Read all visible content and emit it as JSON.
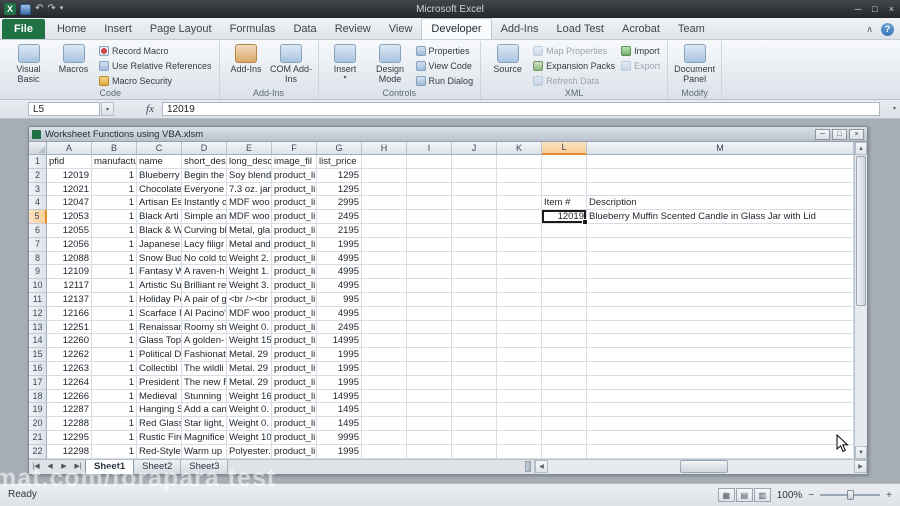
{
  "app": {
    "title": "Microsoft Excel"
  },
  "window_controls": {
    "minimize": "─",
    "maximize": "□",
    "close": "×"
  },
  "qat": {
    "excel": "X",
    "undo": "↶",
    "redo": "↷",
    "dropdown": "▾"
  },
  "tab_row": {
    "tabs": [
      {
        "label": "File",
        "file": true
      },
      {
        "label": "Home"
      },
      {
        "label": "Insert"
      },
      {
        "label": "Page Layout"
      },
      {
        "label": "Formulas"
      },
      {
        "label": "Data"
      },
      {
        "label": "Review"
      },
      {
        "label": "View"
      },
      {
        "label": "Developer",
        "active": true
      },
      {
        "label": "Add-Ins"
      },
      {
        "label": "Load Test"
      },
      {
        "label": "Acrobat"
      },
      {
        "label": "Team"
      }
    ],
    "collapse": "∧",
    "help": "?"
  },
  "ribbon": {
    "groups": [
      {
        "label": "Code",
        "big": [
          {
            "label": "Visual Basic",
            "icon": "visual-basic-icon"
          },
          {
            "label": "Macros",
            "icon": "macros-icon"
          }
        ],
        "cols": [
          [
            {
              "label": "Record Macro",
              "icon": "record-macro-icon"
            },
            {
              "label": "Use Relative References",
              "icon": "relative-references-icon"
            },
            {
              "label": "Macro Security",
              "icon": "macro-security-icon"
            }
          ]
        ]
      },
      {
        "label": "Add-Ins",
        "big": [
          {
            "label": "Add-Ins",
            "icon": "add-ins-icon"
          },
          {
            "label": "COM Add-Ins",
            "icon": "com-add-ins-icon"
          }
        ],
        "cols": []
      },
      {
        "label": "Controls",
        "big": [
          {
            "label": "Insert",
            "icon": "insert-icon",
            "dropdown": true
          },
          {
            "label": "Design Mode",
            "icon": "design-mode-icon"
          }
        ],
        "cols": [
          [
            {
              "label": "Properties",
              "icon": "properties-icon"
            },
            {
              "label": "View Code",
              "icon": "view-code-icon"
            },
            {
              "label": "Run Dialog",
              "icon": "run-dialog-icon"
            }
          ]
        ]
      },
      {
        "label": "XML",
        "big": [
          {
            "label": "Source",
            "icon": "source-icon"
          }
        ],
        "cols": [
          [
            {
              "label": "Map Properties",
              "icon": "map-properties-icon",
              "disabled": true
            },
            {
              "label": "Expansion Packs",
              "icon": "expansion-packs-icon"
            },
            {
              "label": "Refresh Data",
              "icon": "refresh-data-icon",
              "disabled": true
            }
          ],
          [
            {
              "label": "Import",
              "icon": "import-icon"
            },
            {
              "label": "Export",
              "icon": "export-icon",
              "disabled": true
            }
          ]
        ]
      },
      {
        "label": "Modify",
        "big": [
          {
            "label": "Document Panel",
            "icon": "document-panel-icon"
          }
        ],
        "cols": []
      }
    ]
  },
  "formula_bar": {
    "name_box": "L5",
    "fx": "fx",
    "value": "12019",
    "dropdown": "▾"
  },
  "workbook": {
    "title": "Worksheet Functions using VBA.xlsm"
  },
  "grid": {
    "selection": "L5",
    "columns": [
      "A",
      "B",
      "C",
      "D",
      "E",
      "F",
      "G",
      "H",
      "I",
      "J",
      "K",
      "L",
      "M"
    ],
    "rows": [
      [
        "pfid",
        "manufactu",
        "name",
        "short_des",
        "long_desc",
        "image_fil",
        "list_price",
        "",
        "",
        "",
        "",
        "",
        ""
      ],
      [
        "12019",
        "1",
        "Blueberry",
        "Begin the",
        "Soy blend",
        "product_li",
        "1295",
        "",
        "",
        "",
        "",
        "",
        ""
      ],
      [
        "12021",
        "1",
        "Chocolate",
        "Everyone",
        "7.3 oz. jar",
        "product_li",
        "1295",
        "",
        "",
        "",
        "",
        "",
        ""
      ],
      [
        "12047",
        "1",
        "Artisan Es",
        "Instantly c",
        "MDF woo",
        "product_li",
        "2995",
        "",
        "",
        "",
        "",
        "Item #",
        "Description"
      ],
      [
        "12053",
        "1",
        "Black Arti",
        "Simple an",
        "MDF woo",
        "product_li",
        "2495",
        "",
        "",
        "",
        "",
        "12019",
        "Blueberry Muffin Scented Candle in Glass Jar with Lid"
      ],
      [
        "12055",
        "1",
        "Black & W",
        "Curving bl",
        "Metal, gla",
        "product_li",
        "2195",
        "",
        "",
        "",
        "",
        "",
        ""
      ],
      [
        "12056",
        "1",
        "Japanese",
        "Lacy filigr",
        "Metal and",
        "product_li",
        "1995",
        "",
        "",
        "",
        "",
        "",
        ""
      ],
      [
        "12088",
        "1",
        "Snow Bud",
        "No cold tc",
        "Weight 2.",
        "product_li",
        "4995",
        "",
        "",
        "",
        "",
        "",
        ""
      ],
      [
        "12109",
        "1",
        "Fantasy W",
        "A raven-h",
        "Weight 1.",
        "product_li",
        "4995",
        "",
        "",
        "",
        "",
        "",
        ""
      ],
      [
        "12117",
        "1",
        "Artistic Su",
        "Brilliant re",
        "Weight 3.",
        "product_li",
        "4995",
        "",
        "",
        "",
        "",
        "",
        ""
      ],
      [
        "12137",
        "1",
        "Holiday Pe",
        "A pair of g",
        "<br /><br",
        "product_li",
        "995",
        "",
        "",
        "",
        "",
        "",
        ""
      ],
      [
        "12166",
        "1",
        "Scarface N",
        "Al Pacino'",
        "MDF woo",
        "product_li",
        "4995",
        "",
        "",
        "",
        "",
        "",
        ""
      ],
      [
        "12251",
        "1",
        "Renaissan",
        "Roomy sh",
        "Weight 0.",
        "product_li",
        "2495",
        "",
        "",
        "",
        "",
        "",
        ""
      ],
      [
        "12260",
        "1",
        "Glass Top",
        "A golden-",
        "Weight 15",
        "product_li",
        "14995",
        "",
        "",
        "",
        "",
        "",
        ""
      ],
      [
        "12262",
        "1",
        "Political D",
        "Fashionat",
        "Metal. 29",
        "product_li",
        "1995",
        "",
        "",
        "",
        "",
        "",
        ""
      ],
      [
        "12263",
        "1",
        "Collectibl",
        "The wildli",
        "Metal. 29",
        "product_li",
        "1995",
        "",
        "",
        "",
        "",
        "",
        ""
      ],
      [
        "12264",
        "1",
        "President",
        "The new F",
        "Metal. 29",
        "product_li",
        "1995",
        "",
        "",
        "",
        "",
        "",
        ""
      ],
      [
        "12266",
        "1",
        "Medieval",
        "Stunning",
        "Weight 16",
        "product_li",
        "14995",
        "",
        "",
        "",
        "",
        "",
        ""
      ],
      [
        "12287",
        "1",
        "Hanging S",
        "Add a can",
        "Weight 0.",
        "product_li",
        "1495",
        "",
        "",
        "",
        "",
        "",
        ""
      ],
      [
        "12288",
        "1",
        "Red Glass",
        "Star light,",
        "Weight 0.",
        "product_li",
        "1495",
        "",
        "",
        "",
        "",
        "",
        ""
      ],
      [
        "12295",
        "1",
        "Rustic Fire",
        "Magnifice",
        "Weight 10",
        "product_li",
        "9995",
        "",
        "",
        "",
        "",
        "",
        ""
      ],
      [
        "12298",
        "1",
        "Red-Style",
        "Warm up",
        "Polyester.",
        "product_li",
        "1995",
        "",
        "",
        "",
        "",
        "",
        ""
      ]
    ]
  },
  "sheet_bar": {
    "nav": [
      "|◀",
      "◀",
      "▶",
      "▶|"
    ],
    "tabs": [
      "Sheet1",
      "Sheet2",
      "Sheet3"
    ],
    "active": "Sheet1",
    "scroll_left": "◀",
    "scroll_right": "▶"
  },
  "status_bar": {
    "mode": "Ready",
    "views": [
      "▦",
      "▤",
      "▥"
    ],
    "zoom": "100%",
    "zoom_minus": "−",
    "zoom_plus": "+"
  },
  "watermark": "mat.com/forapara test",
  "scroll_glyphs": {
    "up": "▲",
    "down": "▼"
  }
}
